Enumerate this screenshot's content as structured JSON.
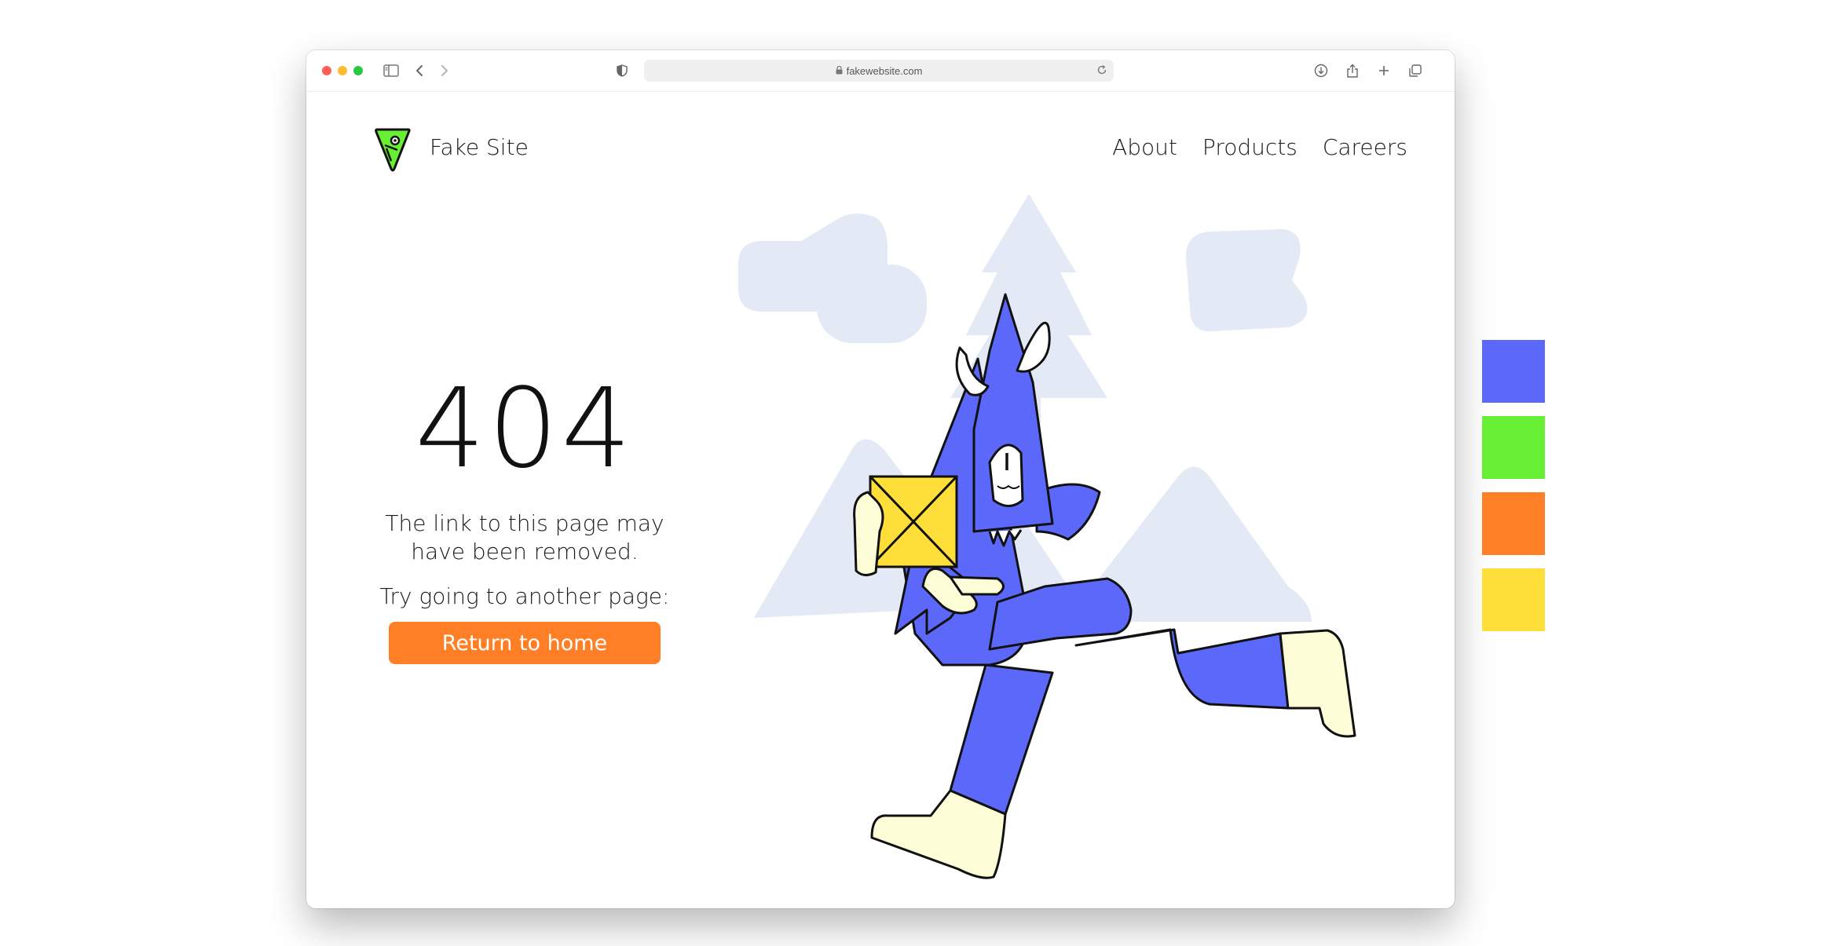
{
  "browser": {
    "url": "fakewebsite.com"
  },
  "site": {
    "name": "Fake Site"
  },
  "nav": {
    "items": [
      "About",
      "Products",
      "Careers"
    ]
  },
  "error": {
    "code": "404",
    "message_line1": "The link to this page may",
    "message_line2": "have been removed.",
    "suggestion": "Try going to another page:",
    "button_label": "Return to home"
  },
  "palette": {
    "colors": [
      "#5b68fa",
      "#67ef33",
      "#ff7f27",
      "#fedf3a"
    ]
  }
}
